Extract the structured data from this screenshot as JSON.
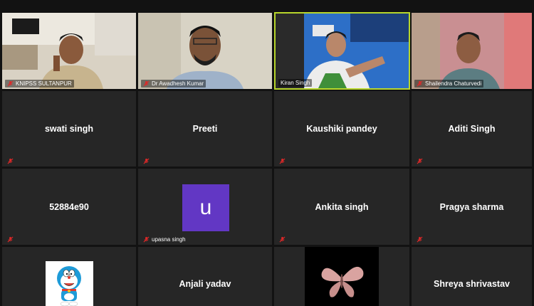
{
  "participants": [
    {
      "name": "KNIPSS SULTANPUR",
      "muted": true,
      "video": true
    },
    {
      "name": "Dr Awadhesh Kumar",
      "muted": true,
      "video": true
    },
    {
      "name": "Kiran Singh",
      "muted": false,
      "video": true,
      "active_speaker": true
    },
    {
      "name": "Shailendra Chaturvedi",
      "muted": true,
      "video": true
    },
    {
      "name": "swati singh",
      "muted": true,
      "video": false
    },
    {
      "name": "Preeti",
      "muted": true,
      "video": false
    },
    {
      "name": "Kaushiki pandey",
      "muted": true,
      "video": false
    },
    {
      "name": "Aditi Singh",
      "muted": true,
      "video": false
    },
    {
      "name": "52884e90",
      "muted": true,
      "video": false
    },
    {
      "name": "upasna singh",
      "muted": true,
      "video": false,
      "avatar_letter": "u"
    },
    {
      "name": "Ankita singh",
      "muted": true,
      "video": false
    },
    {
      "name": "Pragya sharma",
      "muted": true,
      "video": false
    },
    {
      "name": "",
      "muted": false,
      "video": false,
      "profile_image": "doraemon"
    },
    {
      "name": "Anjali yadav",
      "muted": false,
      "video": false
    },
    {
      "name": "",
      "muted": false,
      "video": false,
      "profile_image": "butterfly"
    },
    {
      "name": "Shreya shrivastav",
      "muted": false,
      "video": false
    }
  ],
  "colors": {
    "active_border": "#b8d62b",
    "tile_bg": "#262626",
    "mute_red": "#e02828",
    "avatar_purple": "#6237c4"
  }
}
